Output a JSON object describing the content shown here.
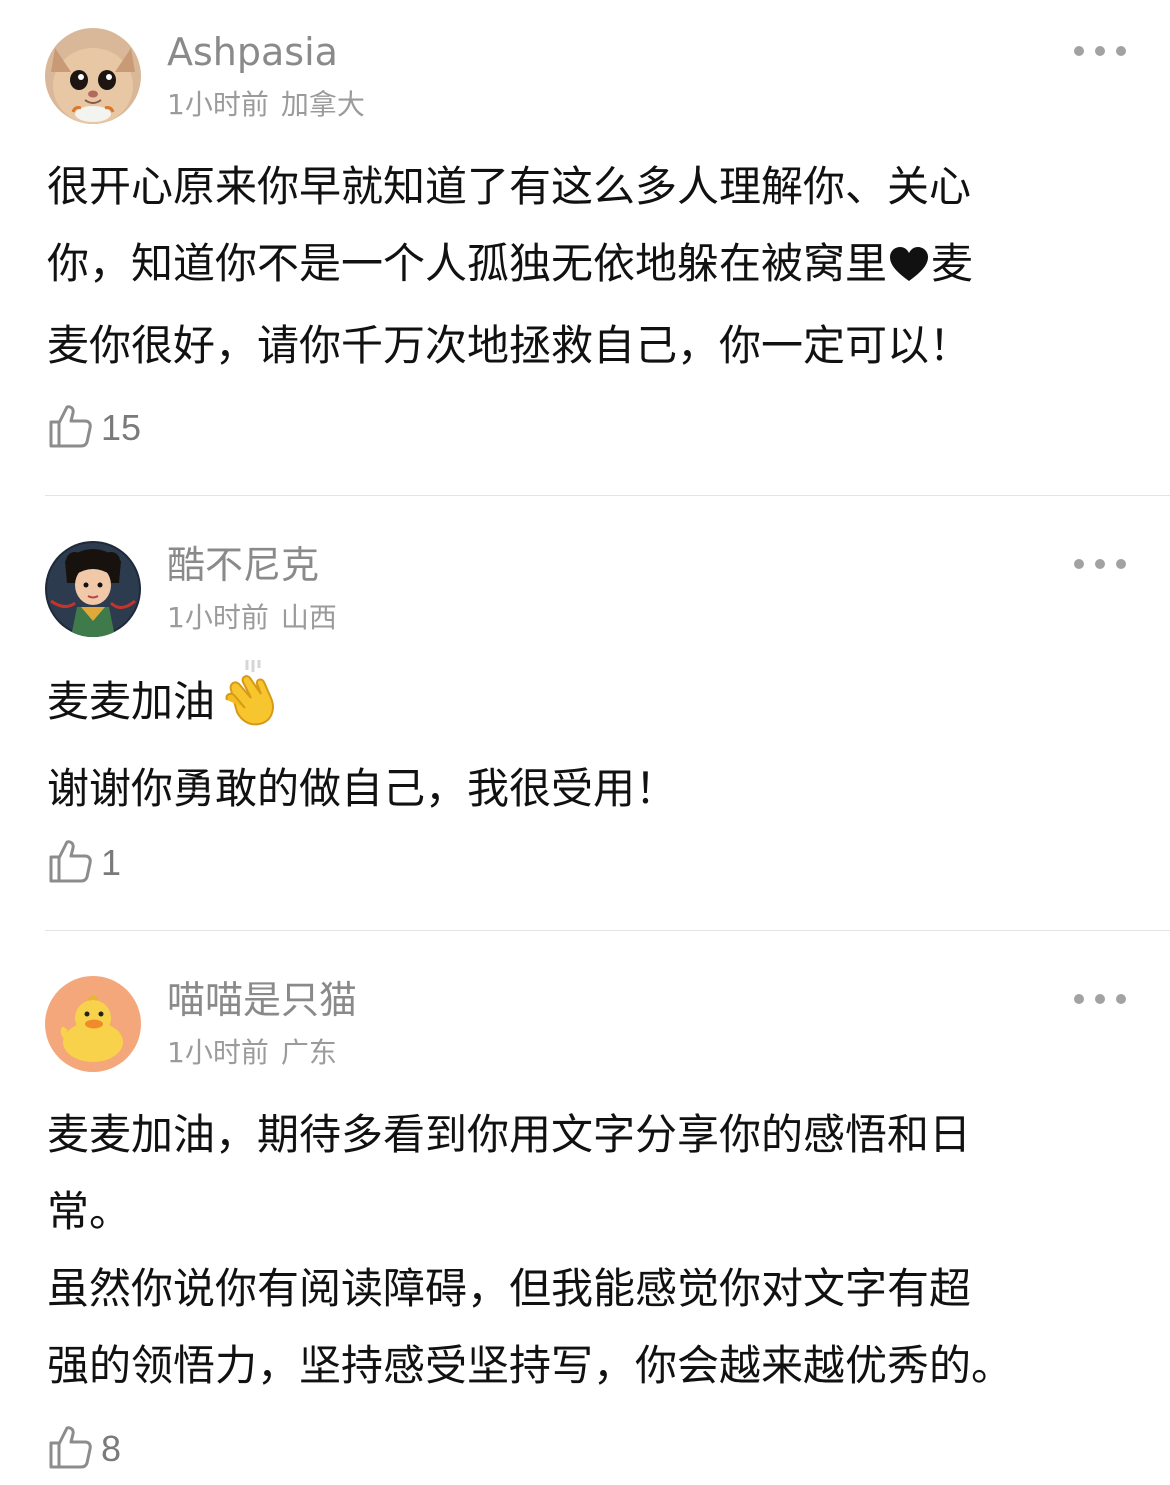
{
  "comments": [
    {
      "username": "Ashpasia",
      "time": "1小时前",
      "location": "加拿大",
      "lines": [
        "很开心原来你早就知道了有这么多人理解你、关心",
        "你，知道你不是一个人孤独无依地躲在被窝里",
        "麦",
        "麦你很好，请你千万次地拯救自己，你一定可以！"
      ],
      "likes": "15",
      "avatar": "cat-avatar"
    },
    {
      "username": "酷不尼克",
      "time": "1小时前",
      "location": "山西",
      "lines": [
        "麦麦加油",
        "谢谢你勇敢的做自己，我很受用！"
      ],
      "likes": "1",
      "avatar": "cartoon-girl-avatar"
    },
    {
      "username": "喵喵是只猫",
      "time": "1小时前",
      "location": "广东",
      "lines": [
        "麦麦加油，期待多看到你用文字分享你的感悟和日",
        "常。",
        "虽然你说你有阅读障碍，但我能感觉你对文字有超",
        "强的领悟力，坚持感受坚持写，你会越来越优秀的。"
      ],
      "likes": "8",
      "avatar": "duck-avatar"
    }
  ],
  "icons": {
    "like": "thumbs-up-icon",
    "more": "more-options-icon",
    "heart": "black-heart-emoji",
    "clap": "clapping-hands-emoji"
  },
  "colors": {
    "username": "#8a8a8a",
    "meta": "#9b9b9b",
    "body": "#111111",
    "icon": "#8c8c8c",
    "divider": "#e4e4e4"
  }
}
